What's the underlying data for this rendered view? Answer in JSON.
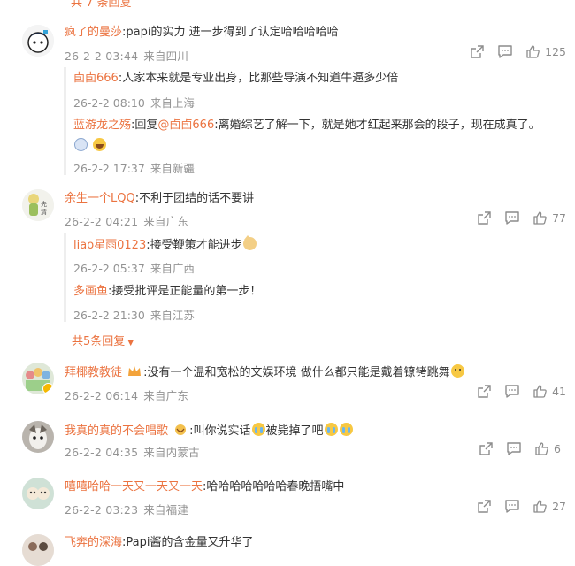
{
  "top_fragment": "共 7 条回复",
  "comments": [
    {
      "username": "疯了的曼莎",
      "text": ":papi的实力 进一步得到了认定哈哈哈哈哈",
      "time": "26-2-2 03:44",
      "location": "来自四川",
      "likes": "125",
      "replies": [
        {
          "username": "卣卣666",
          "text": ":人家本来就是专业出身，比那些导演不知道牛逼多少倍",
          "time": "26-2-2 08:10",
          "location": "来自上海"
        },
        {
          "username": "蓝游龙之殇",
          "text_prefix": ":回复",
          "mention": "@卣卣666",
          "text": ":离婚综艺了解一下，就是她才红起来那会的段子，现在成真了。",
          "time": "26-2-2 17:37",
          "location": "来自新疆"
        }
      ]
    },
    {
      "username": "余生一个LQQ",
      "text": ":不利于团结的话不要讲",
      "time": "26-2-2 04:21",
      "location": "来自广东",
      "likes": "77",
      "replies": [
        {
          "username": "liao星雨0123",
          "text": ":接受鞭策才能进步",
          "time": "26-2-2 05:37",
          "location": "来自广西"
        },
        {
          "username": "多画鱼",
          "text": ":接受批评是正能量的第一步！",
          "time": "26-2-2 21:30",
          "location": "来自江苏"
        }
      ],
      "more_replies": "共5条回复"
    },
    {
      "username": "拜椰教教徒",
      "text": ":没有一个温和宽松的文娱环境 做什么都只能是戴着镣铐跳舞",
      "time": "26-2-2 06:14",
      "location": "来自广东",
      "likes": "41"
    },
    {
      "username": "我真的真的不会唱歌",
      "text_a": ":叫你说实话",
      "text_b": "被毙掉了吧",
      "time": "26-2-2 04:35",
      "location": "来自内蒙古",
      "likes": "6"
    },
    {
      "username": "嘻嘻哈哈一天又一天又一天",
      "text": ":哈哈哈哈哈哈哈春晚捂嘴中",
      "time": "26-2-2 03:23",
      "location": "来自福建",
      "likes": "27"
    },
    {
      "username": "飞奔的深海",
      "text": ":Papi酱的含金量又升华了"
    }
  ],
  "icons": {
    "share": "share-icon",
    "comment": "comment-icon",
    "like": "thumbs-up-icon"
  },
  "colors": {
    "username": "#eb7340",
    "text": "#333333",
    "meta": "#939393"
  }
}
